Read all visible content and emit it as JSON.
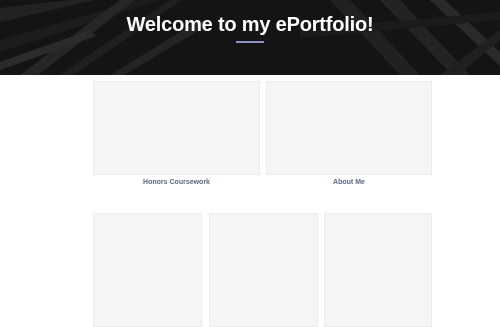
{
  "hero": {
    "title": "Welcome to my ePortfolio!"
  },
  "colors": {
    "hero_background": "#1b1b1d",
    "underline_accent": "#8c94c9",
    "card_background": "#f5f5f5",
    "label_text": "#5b6583"
  },
  "cards_row_1": [
    {
      "label": "Honors Coursework"
    },
    {
      "label": "About Me"
    }
  ],
  "cards_row_2": [
    {
      "label": ""
    },
    {
      "label": ""
    },
    {
      "label": ""
    }
  ]
}
